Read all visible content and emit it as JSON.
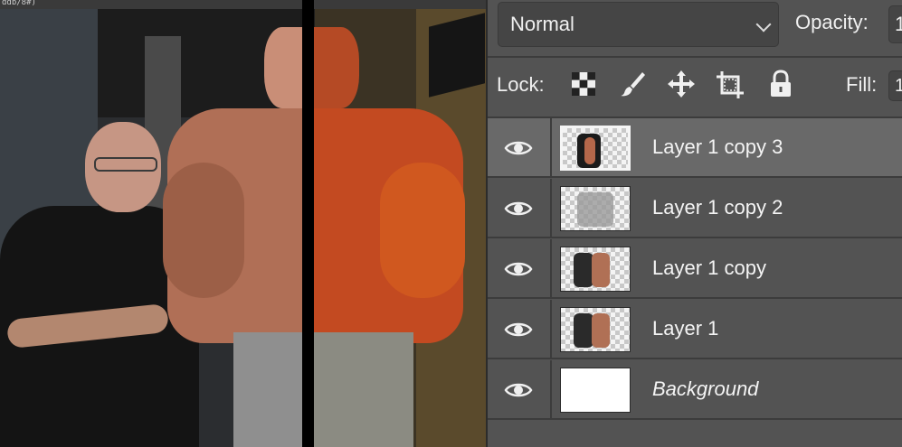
{
  "canvas": {
    "top_strip_text": "ddb/8#)"
  },
  "layers_panel": {
    "blend_mode": "Normal",
    "opacity_label": "Opacity:",
    "opacity_value": "1",
    "lock_label": "Lock:",
    "fill_label": "Fill:",
    "fill_value": "1",
    "lock_icons": [
      "lock-transparent-pixels-icon",
      "lock-image-pixels-icon",
      "lock-position-icon",
      "lock-artboard-icon",
      "lock-all-icon"
    ],
    "layers": [
      {
        "name": "Layer 1 copy 3",
        "selected": true,
        "visible": true,
        "italic": false
      },
      {
        "name": "Layer 1 copy 2",
        "selected": false,
        "visible": true,
        "italic": false
      },
      {
        "name": "Layer 1 copy",
        "selected": false,
        "visible": true,
        "italic": false
      },
      {
        "name": "Layer 1",
        "selected": false,
        "visible": true,
        "italic": false
      },
      {
        "name": "Background",
        "selected": false,
        "visible": true,
        "italic": true
      }
    ]
  },
  "colors": {
    "panel_bg": "#535353",
    "selected_row": "#696969",
    "text": "#f4f4f4"
  }
}
